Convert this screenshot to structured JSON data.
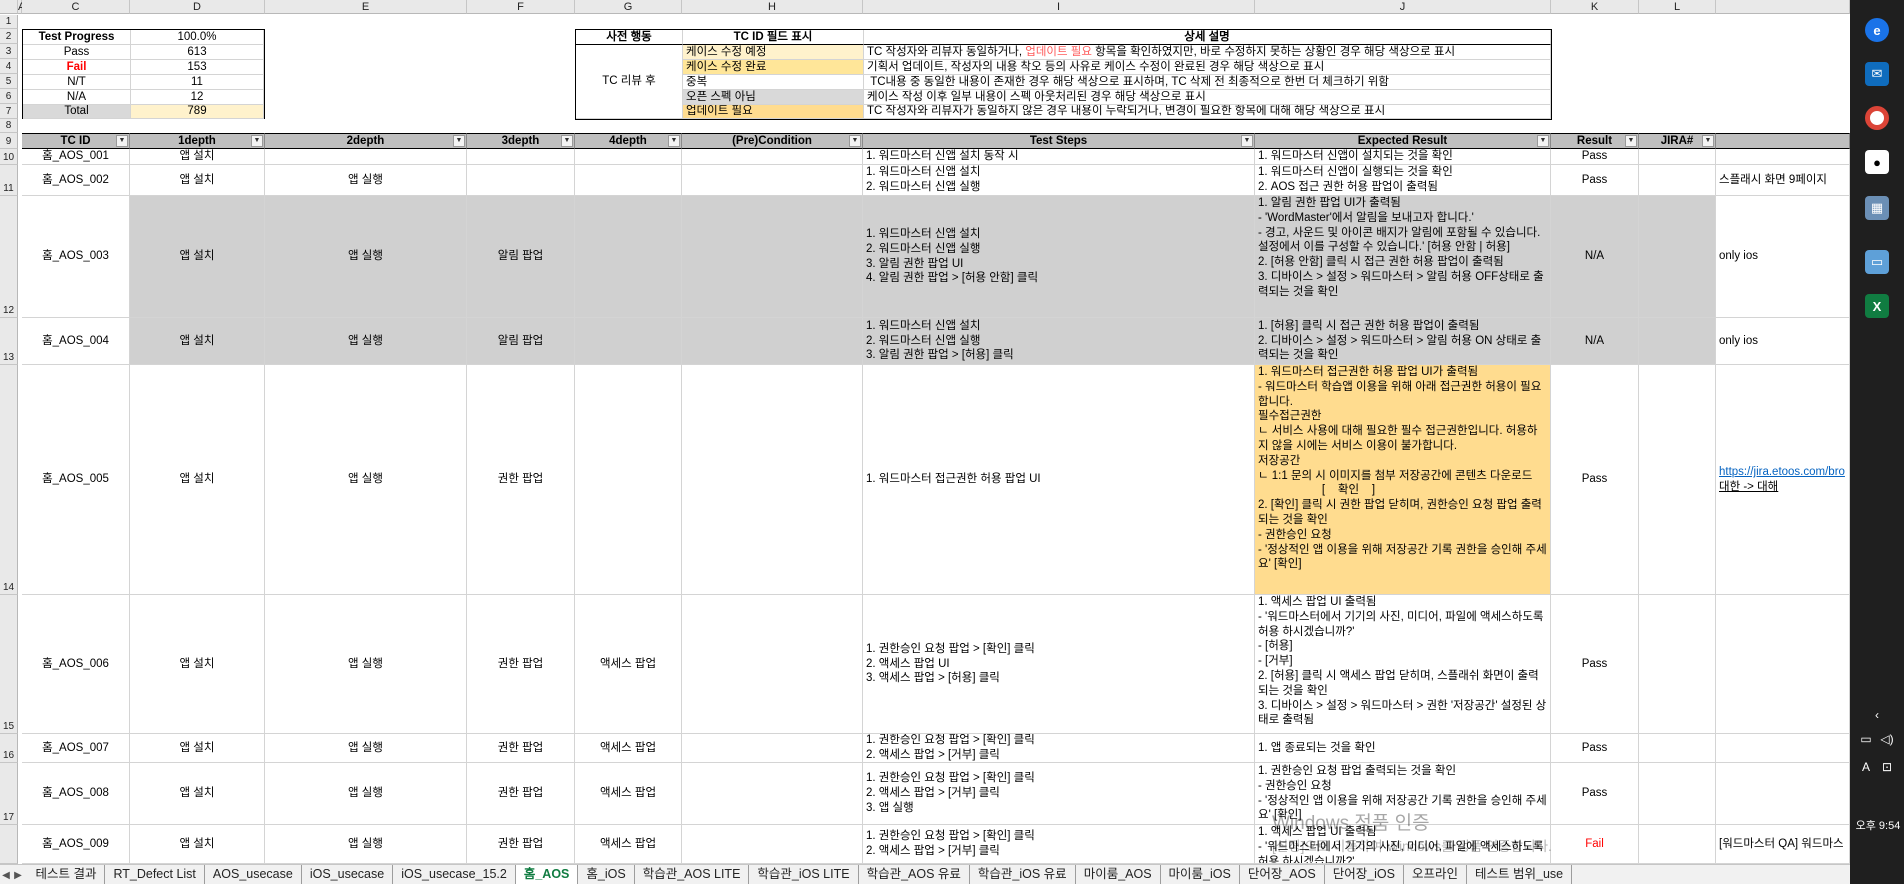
{
  "columns": [
    "A",
    "C",
    "D",
    "E",
    "F",
    "G",
    "H",
    "I",
    "J",
    "K",
    "L"
  ],
  "rows": [
    "1",
    "2",
    "3",
    "4",
    "5",
    "6",
    "7",
    "8",
    "9",
    "10",
    "11",
    "12",
    "13",
    "14",
    "15",
    "16",
    "17"
  ],
  "summary": {
    "items": [
      {
        "label": "Test Progress",
        "value": "100.0%"
      },
      {
        "label": "Pass",
        "value": "613"
      },
      {
        "label": "Fail",
        "value": "153"
      },
      {
        "label": "N/T",
        "value": "11"
      },
      {
        "label": "N/A",
        "value": "12"
      },
      {
        "label": "Total",
        "value": "789"
      }
    ]
  },
  "legend": {
    "header_action": "사전 행동",
    "header_field": "TC ID 필드 표시",
    "header_detail": "상세 설명",
    "action": "TC 리뷰 후",
    "rows": [
      {
        "field": "케이스 수정 예정",
        "detail_a": "TC 작성자와 리뷰자 동일하거나, ",
        "detail_hl": "업데이트 필요",
        "detail_b": " 항목을 확인하였지만, 바로 수정하지 못하는 상황인 경우 해당 색상으로 표시"
      },
      {
        "field": "케이스 수정 완료",
        "detail": "기획서 업데이트, 작성자의 내용 착오 등의 사유로 케이스 수정이 완료된 경우 해당 색상으로 표시"
      },
      {
        "field": "중복",
        "detail": " TC내용 중 동일한 내용이 존재한 경우 해당 색상으로 표시하며, TC 삭제 전 최종적으로 한번 더 체크하기 위함"
      },
      {
        "field": "오픈 스펙 아님",
        "detail": "케이스 작성 이후 일부 내용이 스펙 아웃처리된 경우 해당 색상으로 표시"
      },
      {
        "field": "업데이트 필요",
        "detail": "TC 작성자와 리뷰자가 동일하지 않은 경우 내용이 누락되거나, 변경이 필요한 항목에 대해 해당 색상으로 표시"
      }
    ]
  },
  "table": {
    "headers": {
      "tcid": "TC ID",
      "d1": "1depth",
      "d2": "2depth",
      "d3": "3depth",
      "d4": "4depth",
      "pre": "(Pre)Condition",
      "steps": "Test Steps",
      "expected": "Expected Result",
      "result": "Result",
      "jira": "JIRA#"
    },
    "rows": [
      {
        "tcid": "홈_AOS_001",
        "d1": "앱 설치",
        "d2": "",
        "d3": "",
        "d4": "",
        "steps": "1. 워드마스터 신앱 설치 동작 시",
        "expected": "1. 워드마스터 신앱이 설치되는 것을 확인",
        "result": "Pass",
        "note": ""
      },
      {
        "tcid": "홈_AOS_002",
        "d1": "앱 설치",
        "d2": "앱 실행",
        "d3": "",
        "d4": "",
        "steps": "1. 워드마스터 신앱 설치\n2. 워드마스터 신앱 실행",
        "expected": "1. 워드마스터 신앱이 실행되는 것을 확인\n2. AOS 접근 권한 허용 팝업이 출력됨",
        "result": "Pass",
        "note": "스플래시 화면 9페이지"
      },
      {
        "tcid": "홈_AOS_003",
        "d1": "앱 설치",
        "d2": "앱 실행",
        "d3": "알림 팝업",
        "d4": "",
        "steps": "1. 워드마스터 신앱 설치\n2. 워드마스터 신앱 실행\n3. 알림 권한 팝업 UI\n4. 알림 권한 팝업 > [허용 안함] 클릭",
        "expected": "1. 알림 권한 팝업 UI가 출력됨\n- 'WordMaster'에서 알림을 보내고자 합니다.'\n- 경고, 사운드 및 아이콘 배지가 알림에 포함될 수 있습니다. 설정에서 이를 구성할 수 있습니다.' [허용 안함 | 허용]\n2. [허용 안함] 클릭 시 접근 권한 허용 팝업이 출력됨\n3. 디바이스 > 설정 > 워드마스터 > 알림 허용 OFF상태로 출력되는 것을 확인",
        "result": "N/A",
        "note": "only ios"
      },
      {
        "tcid": "홈_AOS_004",
        "d1": "앱 설치",
        "d2": "앱 실행",
        "d3": "알림 팝업",
        "d4": "",
        "steps": "1. 워드마스터 신앱 설치\n2. 워드마스터 신앱 실행\n3. 알림 권한 팝업 > [허용] 클릭",
        "expected": "1. [허용] 클릭 시 접근 권한 허용 팝업이 출력됨\n2. 디바이스 > 설정 > 워드마스터 > 알림 허용 ON 상태로 출력되는 것을 확인",
        "result": "N/A",
        "note": "only ios"
      },
      {
        "tcid": "홈_AOS_005",
        "d1": "앱 설치",
        "d2": "앱 실행",
        "d3": "권한 팝업",
        "d4": "",
        "steps": "1. 워드마스터 접근권한 허용 팝업 UI",
        "expected": "1. 워드마스터 접근권한 허용 팝업 UI가 출력됨\n- 워드마스터 학습앱 이용을 위해 아래 접근권한 허용이 필요합니다.\n필수접근권한\nㄴ 서비스 사용에 대해 필요한 필수 접근권한입니다. 허용하지 않을 시에는 서비스 이용이 불가합니다.\n저장공간\nㄴ 1:1 문의 시 이미지를 첨부 저장공간에 콘텐츠 다운로드\n                    [    확인    ]\n2. [확인] 클릭 시 권한 팝업 닫히며, 권한승인 요청 팝업 출력되는 것을 확인\n- 권한승인 요청\n- '정상적인 앱 이용을 위해 저장공간 기록 권한을 승인해 주세요' [확인]",
        "result": "Pass",
        "note_link": "https://jira.etoos.com/bro",
        "note_link2": "대한 -> 대해"
      },
      {
        "tcid": "홈_AOS_006",
        "d1": "앱 설치",
        "d2": "앱 실행",
        "d3": "권한 팝업",
        "d4": "액세스 팝업",
        "steps": "1. 권한승인 요청 팝업 > [확인] 클릭\n2. 액세스 팝업 UI\n3. 액세스 팝업 > [허용] 클릭",
        "expected": "1. 액세스 팝업 UI 출력됨\n- '워드마스터에서 기기의 사진, 미디어, 파일에 액세스하도록 허용 하시겠습니까?'\n- [허용]\n- [거부]\n2. [허용] 클릭 시 액세스 팝업 닫히며, 스플래쉬 화면이 출력되는 것을 확인\n3. 디바이스 > 설정 > 워드마스터 > 권한 '저장공간' 설정된 상태로 출력됨",
        "result": "Pass",
        "note": ""
      },
      {
        "tcid": "홈_AOS_007",
        "d1": "앱 설치",
        "d2": "앱 실행",
        "d3": "권한 팝업",
        "d4": "액세스 팝업",
        "steps": "1. 권한승인 요청 팝업 > [확인] 클릭\n2. 액세스 팝업 > [거부] 클릭",
        "expected": "1. 앱 종료되는 것을 확인",
        "result": "Pass",
        "note": ""
      },
      {
        "tcid": "홈_AOS_008",
        "d1": "앱 설치",
        "d2": "앱 실행",
        "d3": "권한 팝업",
        "d4": "액세스 팝업",
        "steps": "1. 권한승인 요청 팝업 > [확인] 클릭\n2. 액세스 팝업 > [거부] 클릭\n3. 앱 실행",
        "expected": "1. 권한승인 요청 팝업 출력되는 것을 확인\n- 권한승인 요청\n- '정상적인 앱 이용을 위해 저장공간 기록 권한을 승인해 주세요' [확인]",
        "result": "Pass",
        "note": ""
      },
      {
        "tcid": "홈_AOS_009",
        "d1": "앱 설치",
        "d2": "앱 실행",
        "d3": "권한 팝업",
        "d4": "액세스 팝업",
        "steps": "1. 권한승인 요청 팝업 > [확인] 클릭\n2. 액세스 팝업 > [거부] 클릭",
        "expected": "1. 액세스 팝업 UI 출력됨\n- '워드마스터에서 기기의 사진, 미디어, 파일에 액세스하도록 허용 하시겠습니까?'",
        "result": "Fail",
        "note": "[워드마스터 QA] 워드마스"
      }
    ]
  },
  "tabs": [
    "테스트 결과",
    "RT_Defect List",
    "AOS_usecase",
    "iOS_usecase",
    "iOS_usecase_15.2",
    "홈_AOS",
    "홈_iOS",
    "학습관_AOS LITE",
    "학습관_iOS LITE",
    "학습관_AOS 유료",
    "학습관_iOS 유료",
    "마이룸_AOS",
    "마이룸_iOS",
    "단어장_AOS",
    "단어장_iOS",
    "오프라인",
    "테스트 범위_use"
  ],
  "active_tab": "홈_AOS",
  "watermark": {
    "title": "Windows 정품 인증",
    "subtitle": "[설정]으로 이동하여 Windows를 정품 인증합니다."
  },
  "taskbar": {
    "time": "오후 9:54",
    "lang": "A"
  },
  "colors": {
    "header_gray": "#bfbfbf",
    "update_needed": "#ffdc8f",
    "fail_red": "#ff0000",
    "excel_green": "#107c41"
  }
}
